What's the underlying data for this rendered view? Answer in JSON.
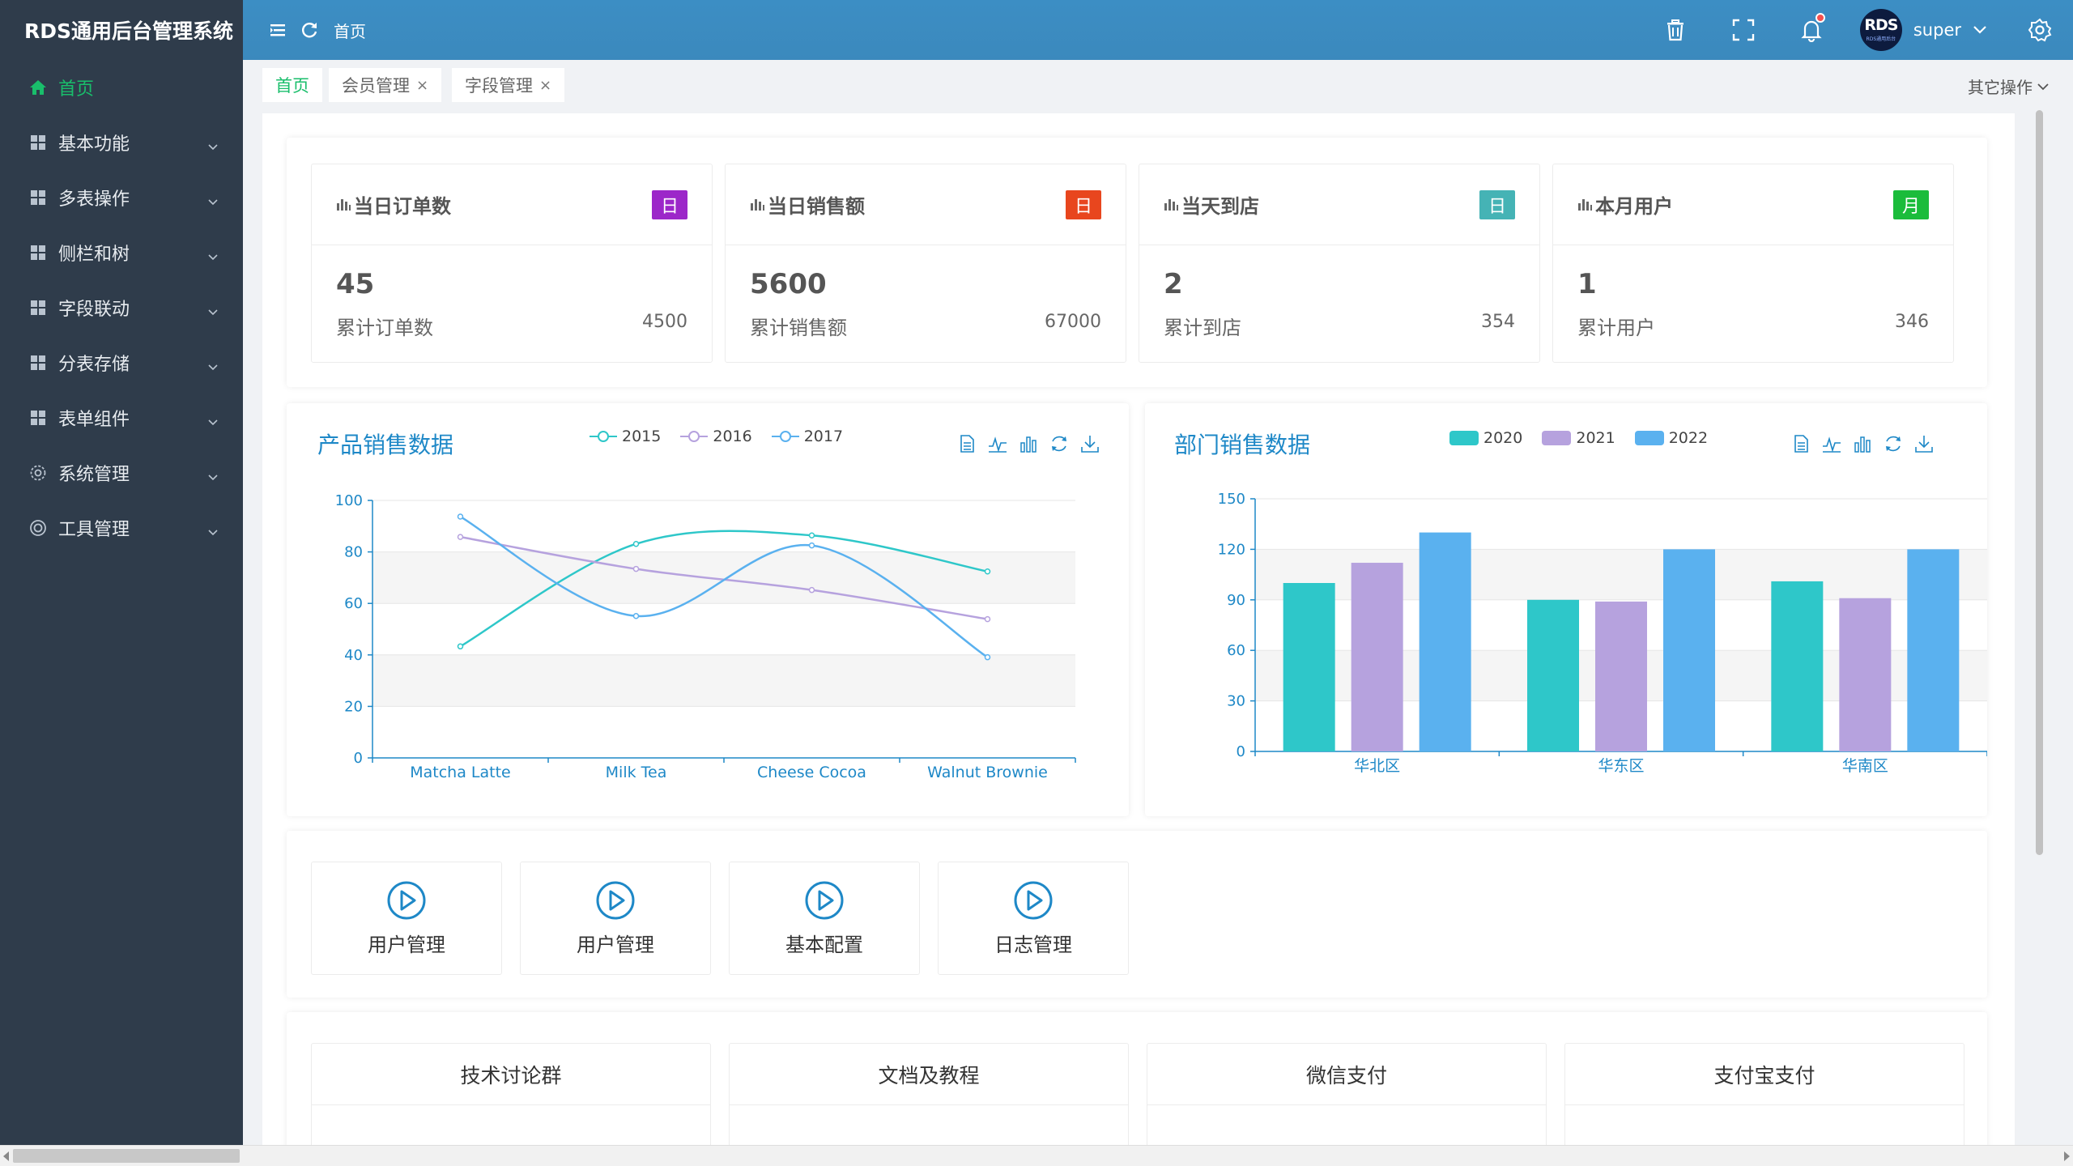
{
  "app": {
    "title": "RDS通用后台管理系统"
  },
  "colors": {
    "sidebar_bg": "#2f3c4b",
    "header_bg": "#3c8ec4",
    "accent_green": "#19be6b",
    "title_blue": "#1e88c7",
    "badge_purple": "#9c27b0",
    "badge_red": "#e64a19",
    "badge_teal": "#3fb4b4",
    "badge_green": "#19be3b"
  },
  "sidebar": {
    "items": [
      {
        "label": "首页",
        "icon": "home-icon",
        "active": true
      },
      {
        "label": "基本功能",
        "icon": "grid-icon"
      },
      {
        "label": "多表操作",
        "icon": "grid-icon"
      },
      {
        "label": "侧栏和树",
        "icon": "grid-icon"
      },
      {
        "label": "字段联动",
        "icon": "grid-icon"
      },
      {
        "label": "分表存储",
        "icon": "grid-icon"
      },
      {
        "label": "表单组件",
        "icon": "grid-icon"
      },
      {
        "label": "系统管理",
        "icon": "gear-icon"
      },
      {
        "label": "工具管理",
        "icon": "tool-icon"
      }
    ]
  },
  "header": {
    "breadcrumb": "首页",
    "avatar_text": "RDS",
    "avatar_sub": "RDS通用后台",
    "username": "super"
  },
  "tabs": [
    {
      "label": "首页",
      "active": true,
      "closable": false
    },
    {
      "label": "会员管理",
      "active": false,
      "closable": true
    },
    {
      "label": "字段管理",
      "active": false,
      "closable": true
    }
  ],
  "tabs_close_glyph": "×",
  "other_ops_label": "其它操作",
  "stats": [
    {
      "title": "当日订单数",
      "badge": "日",
      "badge_color": "#9c27c9",
      "value": "45",
      "footer_label": "累计订单数",
      "footer_value": "4500"
    },
    {
      "title": "当日销售额",
      "badge": "日",
      "badge_color": "#e8461e",
      "value": "5600",
      "footer_label": "累计销售额",
      "footer_value": "67000"
    },
    {
      "title": "当天到店",
      "badge": "日",
      "badge_color": "#45b3b5",
      "value": "2",
      "footer_label": "累计到店",
      "footer_value": "354"
    },
    {
      "title": "本月用户",
      "badge": "月",
      "badge_color": "#1bbc3b",
      "value": "1",
      "footer_label": "累计用户",
      "footer_value": "346"
    }
  ],
  "chart_data": [
    {
      "type": "line",
      "title": "产品销售数据",
      "categories": [
        "Matcha Latte",
        "Milk Tea",
        "Cheese Cocoa",
        "Walnut Brownie"
      ],
      "series": [
        {
          "name": "2015",
          "values": [
            43.3,
            83.1,
            86.4,
            72.4
          ],
          "color": "#2ec7c9"
        },
        {
          "name": "2016",
          "values": [
            85.8,
            73.4,
            65.2,
            53.9
          ],
          "color": "#b6a2de"
        },
        {
          "name": "2017",
          "values": [
            93.7,
            55.1,
            82.5,
            39.1
          ],
          "color": "#5ab1ef"
        }
      ],
      "ylim": [
        0,
        100
      ],
      "yticks": [
        0,
        20,
        40,
        60,
        80,
        100
      ],
      "grid": true,
      "legend": "top"
    },
    {
      "type": "bar",
      "title": "部门销售数据",
      "categories": [
        "华北区",
        "华东区",
        "华南区"
      ],
      "series": [
        {
          "name": "2020",
          "values": [
            100,
            90,
            101
          ],
          "color": "#2ec7c9"
        },
        {
          "name": "2021",
          "values": [
            112,
            89,
            91
          ],
          "color": "#b6a2de"
        },
        {
          "name": "2022",
          "values": [
            130,
            120,
            120
          ],
          "color": "#5ab1ef"
        }
      ],
      "ylim": [
        0,
        150
      ],
      "yticks": [
        0,
        30,
        60,
        90,
        120,
        150
      ],
      "grid": true,
      "legend": "top"
    }
  ],
  "quick_buttons": [
    {
      "label": "用户管理"
    },
    {
      "label": "用户管理"
    },
    {
      "label": "基本配置"
    },
    {
      "label": "日志管理"
    }
  ],
  "bottom_cards": [
    {
      "title": "技术讨论群"
    },
    {
      "title": "文档及教程"
    },
    {
      "title": "微信支付"
    },
    {
      "title": "支付宝支付"
    }
  ]
}
